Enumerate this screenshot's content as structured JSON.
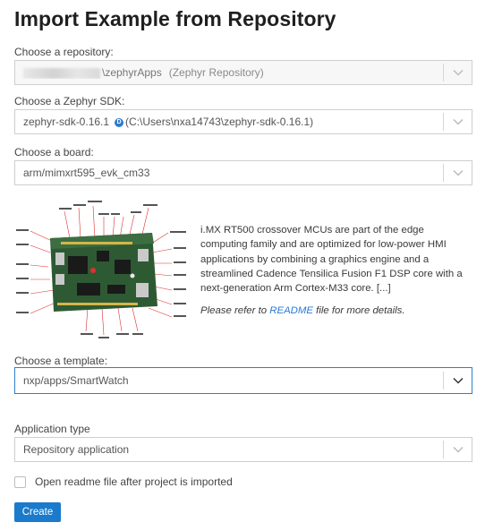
{
  "page": {
    "title": "Import Example from Repository"
  },
  "repository": {
    "label": "Choose a repository:",
    "value_path": "\\zephyrApps",
    "value_note": "(Zephyr Repository)"
  },
  "sdk": {
    "label": "Choose a Zephyr SDK:",
    "name": "zephyr-sdk-0.16.1",
    "info_glyph": "D",
    "path": "(C:\\Users\\nxa14743\\zephyr-sdk-0.16.1)"
  },
  "board": {
    "label": "Choose a board:",
    "value": "arm/mimxrt595_evk_cm33",
    "image_callouts": [
      "BLE/ FXOS Tablet Switch",
      "Audio Jack Mic / Out",
      "FRDM Ckt",
      "I/O",
      "SWD",
      "Audio Jack",
      "LEDs",
      "Leds RGB",
      "USB DIMS",
      "EXPANSION LINKS BOARD"
    ],
    "description": "i.MX RT500 crossover MCUs are part of the edge computing family and are optimized for low-power HMI applications by combining a graphics engine and a streamlined Cadence Tensilica Fusion F1 DSP core with a next-generation Arm Cortex-M33 core. [...]",
    "note_prefix": "Please refer to",
    "note_link": "README",
    "note_suffix": "file for more details."
  },
  "template": {
    "label": "Choose a template:",
    "value": "nxp/apps/SmartWatch"
  },
  "app_type": {
    "label": "Application type",
    "value": "Repository application"
  },
  "readme_checkbox": {
    "label": "Open readme file after project is imported",
    "checked": false
  },
  "actions": {
    "create_label": "Create"
  },
  "colors": {
    "accent": "#1a7acb",
    "focus_border": "#2f80c8"
  }
}
